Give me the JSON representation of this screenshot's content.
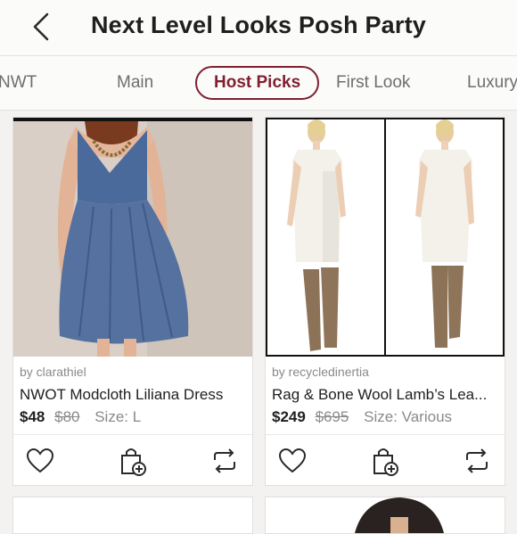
{
  "header": {
    "title": "Next Level Looks Posh Party"
  },
  "tabs": [
    {
      "label": "NWT"
    },
    {
      "label": "Main"
    },
    {
      "label": "Host Picks"
    },
    {
      "label": "First Look"
    },
    {
      "label": "Luxury"
    }
  ],
  "listings": [
    {
      "seller": "by clarathiel",
      "title": "NWOT Modcloth Liliana Dress",
      "price": "$48",
      "original_price": "$80",
      "size": "Size: L"
    },
    {
      "seller": "by recycledinertia",
      "title": "Rag & Bone Wool Lamb’s Lea...",
      "price": "$249",
      "original_price": "$695",
      "size": "Size: Various"
    }
  ],
  "icons": {
    "back": "chevron-left-icon",
    "like": "heart-icon",
    "bundle": "shopping-bag-plus-icon",
    "share": "share-arrows-icon"
  },
  "colors": {
    "accent": "#7f1f2f",
    "background": "#f3f2f0"
  }
}
